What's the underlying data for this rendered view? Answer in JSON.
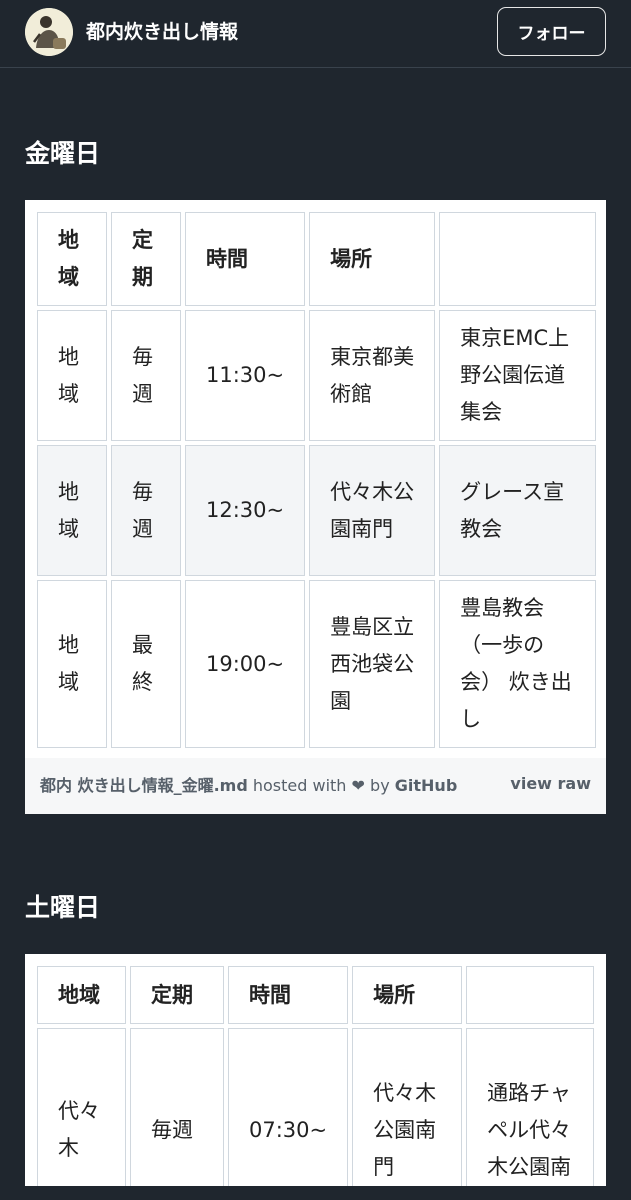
{
  "header": {
    "site_title": "都内炊き出し情報",
    "follow_label": "フォロー",
    "avatar_icon": "man-with-bag-illustration-icon"
  },
  "sections": [
    {
      "heading": "金曜日",
      "table": {
        "headers": [
          "地域",
          "定期",
          "時間",
          "場所",
          ""
        ],
        "rows": [
          [
            "地域",
            "毎週",
            "11:30~",
            "東京都美術館",
            "東京EMC上野公園伝道集会"
          ],
          [
            "地域",
            "毎週",
            "12:30~",
            "代々木公園南門",
            "グレース宣教会"
          ],
          [
            "地域",
            "最終",
            "19:00~",
            "豊島区立西池袋公園",
            "豊島教会（一歩の会） 炊き出し"
          ]
        ]
      },
      "footer": {
        "filename": "都内 炊き出し情報_金曜.md",
        "hosted_with": "hosted with",
        "by": "by",
        "host": "GitHub",
        "view_raw": "view raw"
      }
    },
    {
      "heading": "土曜日",
      "table": {
        "headers": [
          "地域",
          "定期",
          "時間",
          "場所",
          ""
        ],
        "rows": [
          [
            "代々木",
            "毎週",
            "07:30~",
            "代々木公園南門",
            "通路チャペル代々木公園南"
          ]
        ]
      }
    }
  ],
  "colors": {
    "background": "#1f262e",
    "card": "#ffffff",
    "cell_border": "#d0d7de",
    "alt_row": "#f3f5f7"
  }
}
